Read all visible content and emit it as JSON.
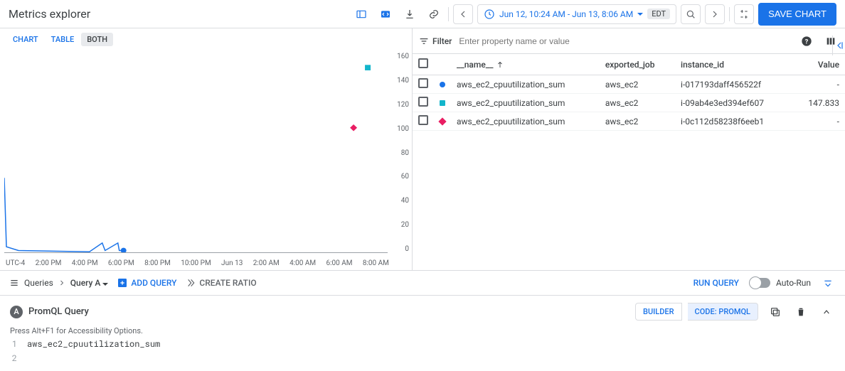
{
  "header": {
    "title": "Metrics explorer",
    "time_range": "Jun 12, 10:24 AM - Jun 13, 8:06 AM",
    "tz": "EDT",
    "save_label": "SAVE CHART"
  },
  "view_tabs": {
    "chart": "CHART",
    "table": "TABLE",
    "both": "BOTH"
  },
  "chart_data": {
    "type": "scatter_line",
    "y_ticks": [
      "160",
      "140",
      "120",
      "100",
      "80",
      "60",
      "40",
      "20",
      "0"
    ],
    "x_ticks": [
      "UTC-4",
      "2:00 PM",
      "4:00 PM",
      "6:00 PM",
      "8:00 PM",
      "10:00 PM",
      "Jun 13",
      "2:00 AM",
      "4:00 AM",
      "6:00 AM",
      "8:00 AM"
    ],
    "series": [
      {
        "name": "i-017193daff456522f",
        "color": "#1a73e8",
        "type": "line",
        "points": [
          [
            0,
            60
          ],
          [
            3,
            5
          ],
          [
            20,
            2
          ],
          [
            120,
            1
          ],
          [
            138,
            8
          ],
          [
            142,
            2
          ],
          [
            160,
            8
          ],
          [
            162,
            2
          ],
          [
            168,
            2
          ]
        ],
        "end_marker": {
          "x": 168,
          "y": 2,
          "shape": "circle"
        }
      },
      {
        "name": "i-09ab4e3ed394ef607",
        "color": "#12b5cb",
        "type": "point",
        "marker": {
          "x": 512,
          "y": 148,
          "shape": "square"
        }
      },
      {
        "name": "i-0c112d58238f6eeb1",
        "color": "#e91e63",
        "type": "point",
        "marker": {
          "x": 492,
          "y": 100,
          "shape": "diamond"
        }
      }
    ],
    "ylim": [
      0,
      160
    ]
  },
  "table": {
    "filter_label": "Filter",
    "filter_placeholder": "Enter property name or value",
    "columns": {
      "name": "__name__",
      "exported_job": "exported_job",
      "instance_id": "instance_id",
      "value": "Value"
    },
    "rows": [
      {
        "marker_shape": "circle",
        "marker_color": "#1a73e8",
        "name": "aws_ec2_cpuutilization_sum",
        "exported_job": "aws_ec2",
        "instance_id": "i-017193daff456522f",
        "value": "-"
      },
      {
        "marker_shape": "square",
        "marker_color": "#12b5cb",
        "name": "aws_ec2_cpuutilization_sum",
        "exported_job": "aws_ec2",
        "instance_id": "i-09ab4e3ed394ef607",
        "value": "147.833"
      },
      {
        "marker_shape": "diamond",
        "marker_color": "#e91e63",
        "name": "aws_ec2_cpuutilization_sum",
        "exported_job": "aws_ec2",
        "instance_id": "i-0c112d58238f6eeb1",
        "value": "-"
      }
    ]
  },
  "query_bar": {
    "queries_label": "Queries",
    "current": "Query A",
    "add_query": "ADD QUERY",
    "create_ratio": "CREATE RATIO",
    "run_query": "RUN QUERY",
    "auto_run": "Auto-Run"
  },
  "editor": {
    "badge": "A",
    "title": "PromQL Query",
    "builder": "BUILDER",
    "code": "CODE: PROMQL",
    "hint": "Press Alt+F1 for Accessibility Options.",
    "line1_no": "1",
    "line1": "aws_ec2_cpuutilization_sum",
    "line2_no": "2"
  }
}
